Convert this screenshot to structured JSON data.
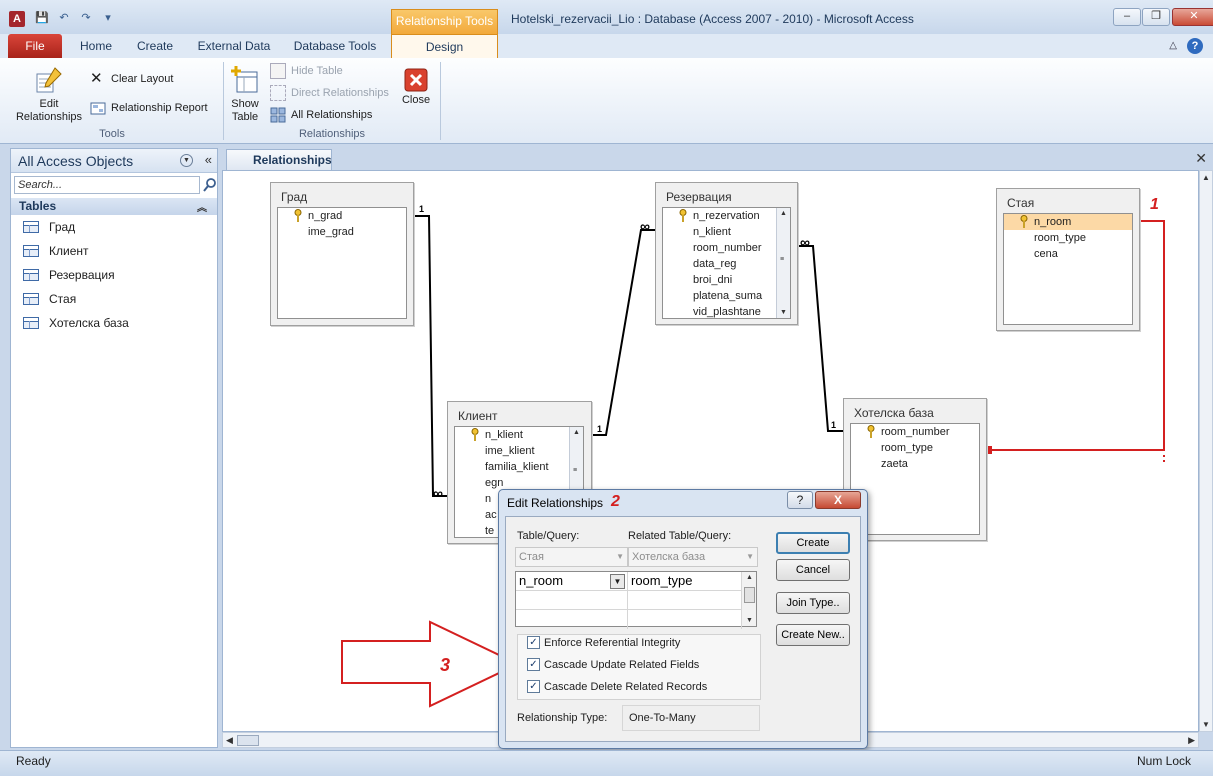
{
  "window": {
    "title": "Hotelski_rezervacii_Lio : Database (Access 2007 - 2010)  -  Microsoft Access",
    "context_tab": "Relationship Tools",
    "app_letter": "A"
  },
  "ribbon_tabs": {
    "file": "File",
    "home": "Home",
    "create": "Create",
    "external_data": "External Data",
    "database_tools": "Database Tools",
    "design": "Design"
  },
  "ribbon": {
    "edit_relationships": "Edit Relationships",
    "clear_layout": "Clear Layout",
    "relationship_report": "Relationship Report",
    "tools_group": "Tools",
    "show_table": "Show Table",
    "hide_table": "Hide Table",
    "direct_relationships": "Direct Relationships",
    "all_relationships": "All Relationships",
    "relationships_group": "Relationships",
    "close": "Close"
  },
  "nav": {
    "title": "All Access Objects",
    "search_placeholder": "Search...",
    "group": "Tables",
    "items": [
      "Град",
      "Клиент",
      "Резервация",
      "Стая",
      "Хотелска база"
    ]
  },
  "document": {
    "tab": "Relationships"
  },
  "tables": {
    "grad": {
      "name": "Град",
      "fields": [
        "n_grad",
        "ime_grad"
      ]
    },
    "rezervacia": {
      "name": "Резервация",
      "fields": [
        "n_rezervation",
        "n_klient",
        "room_number",
        "data_reg",
        "broi_dni",
        "platena_suma",
        "vid_plashtane"
      ]
    },
    "staya": {
      "name": "Стая",
      "fields": [
        "n_room",
        "room_type",
        "cena"
      ]
    },
    "klient": {
      "name": "Клиент",
      "fields": [
        "n_klient",
        "ime_klient",
        "familia_klient",
        "egn",
        "n",
        "ac",
        "te"
      ]
    },
    "hotelska": {
      "name": "Хотелска база",
      "fields": [
        "room_number",
        "room_type",
        "zaeta"
      ]
    }
  },
  "relation_labels": {
    "one": "1",
    "many": "∞"
  },
  "dialog": {
    "title": "Edit Relationships",
    "help": "?",
    "close": "X",
    "table_query_label": "Table/Query:",
    "related_label": "Related Table/Query:",
    "table_value": "Стая",
    "related_value": "Хотелска база",
    "left_field": "n_room",
    "right_field": "room_type",
    "enforce": "Enforce Referential Integrity",
    "cascade_update": "Cascade Update Related Fields",
    "cascade_delete": "Cascade Delete Related Records",
    "rel_type_label": "Relationship Type:",
    "rel_type_value": "One-To-Many",
    "btn_create": "Create",
    "btn_cancel": "Cancel",
    "btn_join": "Join Type..",
    "btn_create_new": "Create New.."
  },
  "annotations": {
    "one": "1",
    "two": "2",
    "three": "3"
  },
  "status": {
    "left": "Ready",
    "right": "Num Lock"
  },
  "colors": {
    "accent_red": "#d42020",
    "selected_field": "#fcd9a6",
    "context_orange": "#f2a93b"
  }
}
